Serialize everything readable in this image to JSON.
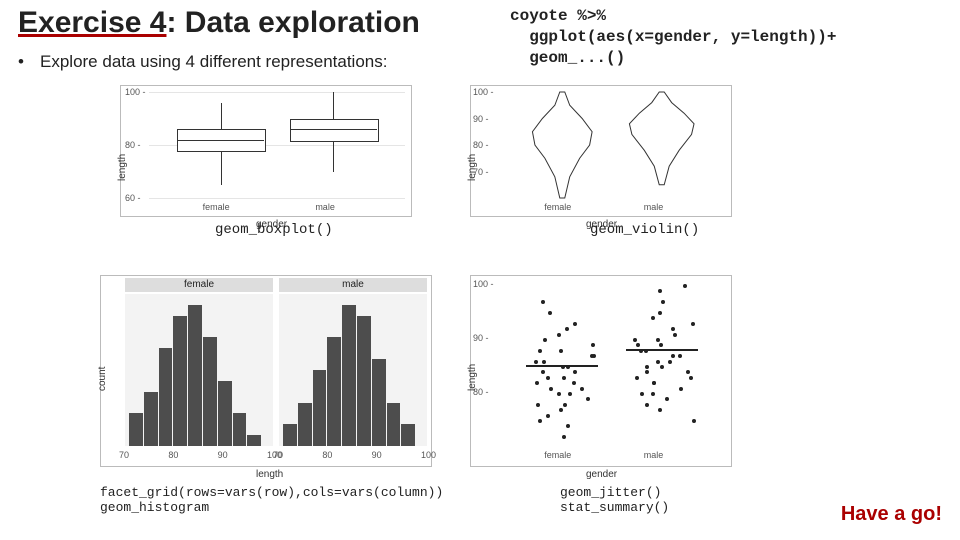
{
  "title_prefix": "Exercise 4",
  "title_suffix": ": Data exploration",
  "bullet_text": "Explore data using 4 different representations:",
  "code_text": "coyote %>%\n  ggplot(aes(x=gender, y=length))+\n  geom_...()",
  "labels": {
    "boxplot": "geom_boxplot()",
    "violin": "geom_violin()",
    "hist": "facet_grid(rows=vars(row),cols=vars(column))\ngeom_histogram",
    "jitter": "geom_jitter()\nstat_summary()"
  },
  "axis": {
    "gender": "gender",
    "length": "length",
    "count": "count",
    "female": "female",
    "male": "male"
  },
  "have_a_go": "Have a go!",
  "chart_data": [
    {
      "type": "boxplot",
      "xlabel": "gender",
      "ylabel": "length",
      "ylim": [
        60,
        100
      ],
      "yticks": [
        60,
        80,
        100
      ],
      "categories": [
        "female",
        "male"
      ],
      "boxes": [
        {
          "category": "female",
          "min": 65,
          "q1": 78,
          "median": 82,
          "q3": 86,
          "max": 96
        },
        {
          "category": "male",
          "min": 70,
          "q1": 82,
          "median": 86,
          "q3": 90,
          "max": 100
        }
      ]
    },
    {
      "type": "violin",
      "xlabel": "gender",
      "ylabel": "length",
      "ylim": [
        60,
        100
      ],
      "yticks": [
        70,
        80,
        90,
        100
      ],
      "categories": [
        "female",
        "male"
      ],
      "series": [
        {
          "name": "female",
          "profile": [
            [
              60,
              0.05
            ],
            [
              68,
              0.15
            ],
            [
              75,
              0.35
            ],
            [
              80,
              0.55
            ],
            [
              85,
              0.6
            ],
            [
              90,
              0.4
            ],
            [
              95,
              0.15
            ],
            [
              100,
              0.05
            ]
          ]
        },
        {
          "name": "male",
          "profile": [
            [
              65,
              0.05
            ],
            [
              72,
              0.15
            ],
            [
              78,
              0.35
            ],
            [
              84,
              0.6
            ],
            [
              88,
              0.65
            ],
            [
              92,
              0.45
            ],
            [
              96,
              0.2
            ],
            [
              100,
              0.05
            ]
          ]
        }
      ]
    },
    {
      "type": "histogram",
      "facets": [
        "female",
        "male"
      ],
      "xlabel": "length",
      "ylabel": "count",
      "xlim": [
        70,
        100
      ],
      "xticks": [
        70,
        80,
        90,
        100
      ],
      "series": [
        {
          "name": "female",
          "bins": [
            {
              "x": 72,
              "c": 3
            },
            {
              "x": 75,
              "c": 5
            },
            {
              "x": 78,
              "c": 9
            },
            {
              "x": 81,
              "c": 12
            },
            {
              "x": 84,
              "c": 13
            },
            {
              "x": 87,
              "c": 10
            },
            {
              "x": 90,
              "c": 6
            },
            {
              "x": 93,
              "c": 3
            },
            {
              "x": 96,
              "c": 1
            }
          ]
        },
        {
          "name": "male",
          "bins": [
            {
              "x": 75,
              "c": 2
            },
            {
              "x": 78,
              "c": 4
            },
            {
              "x": 81,
              "c": 7
            },
            {
              "x": 84,
              "c": 10
            },
            {
              "x": 87,
              "c": 13
            },
            {
              "x": 90,
              "c": 12
            },
            {
              "x": 93,
              "c": 8
            },
            {
              "x": 96,
              "c": 4
            },
            {
              "x": 99,
              "c": 2
            }
          ]
        }
      ]
    },
    {
      "type": "scatter",
      "xlabel": "gender",
      "ylabel": "length",
      "ylim": [
        70,
        100
      ],
      "yticks": [
        80,
        90,
        100
      ],
      "categories": [
        "female",
        "male"
      ],
      "means": {
        "female": 85,
        "male": 88
      },
      "points": {
        "female": [
          72,
          74,
          75,
          76,
          77,
          78,
          78,
          79,
          80,
          80,
          81,
          81,
          82,
          82,
          83,
          83,
          84,
          84,
          85,
          85,
          86,
          86,
          87,
          87,
          88,
          88,
          89,
          90,
          91,
          92,
          93,
          95,
          97
        ],
        "male": [
          75,
          77,
          78,
          79,
          80,
          80,
          81,
          82,
          82,
          83,
          83,
          84,
          84,
          85,
          85,
          86,
          86,
          87,
          87,
          88,
          88,
          89,
          89,
          90,
          90,
          91,
          92,
          93,
          94,
          95,
          97,
          99,
          100
        ]
      }
    }
  ]
}
